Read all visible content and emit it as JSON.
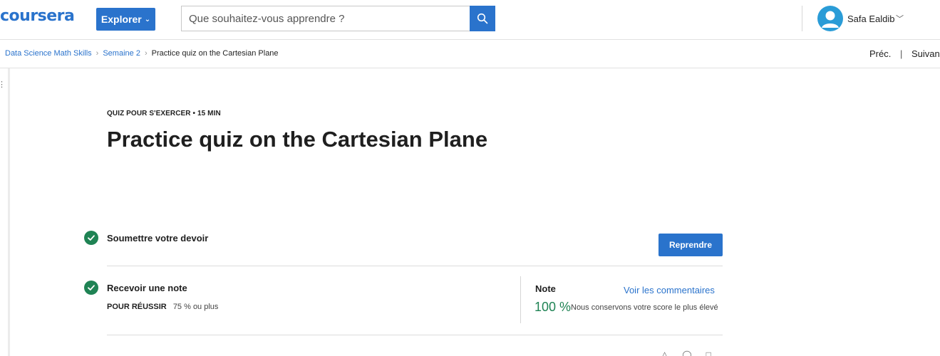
{
  "header": {
    "logo": "coursera",
    "explore_label": "Explorer",
    "search_placeholder": "Que souhaitez-vous apprendre ?",
    "user_name": "Safa Ealdib"
  },
  "breadcrumb": {
    "items": [
      "Data Science Math Skills",
      "Semaine 2"
    ],
    "current": "Practice quiz on the Cartesian Plane",
    "prev_label": "Préc.",
    "separator": "|",
    "next_label": "Suivant"
  },
  "quiz": {
    "kicker": "QUIZ POUR S'EXERCER • 15  MIN",
    "title": "Practice quiz on the Cartesian Plane",
    "submit_step_title": "Soumettre votre devoir",
    "retry_label": "Reprendre",
    "grade_step_title": "Recevoir une note",
    "pass_label": "POUR RÉUSSIR",
    "pass_value": "75 % ou plus",
    "grade_label": "Note",
    "feedback_label": "Voir les commentaires",
    "grade_value": "100 %",
    "grade_note": "Nous conservons votre score le plus élevé"
  },
  "colors": {
    "brand": "#2a73cc",
    "success": "#1f8354",
    "avatar": "#2a9cd7"
  },
  "icons": [
    "search-icon",
    "chevron-down-icon",
    "user-avatar-icon",
    "check-circle-icon",
    "menu-icon"
  ]
}
